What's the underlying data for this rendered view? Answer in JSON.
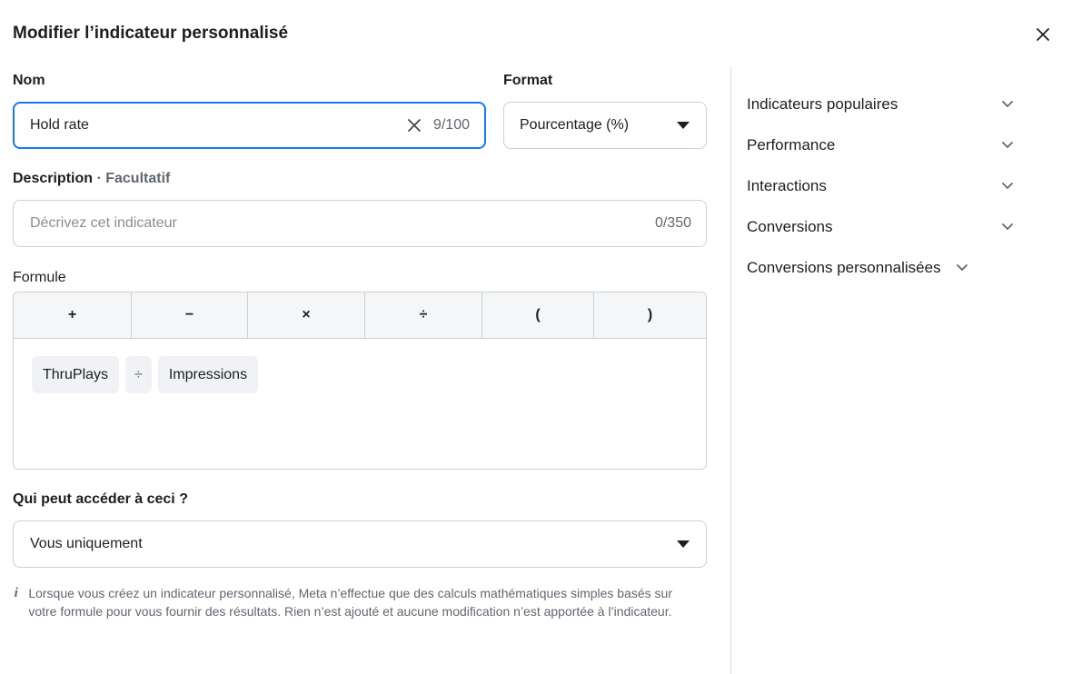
{
  "dialog": {
    "title": "Modifier l’indicateur personnalisé",
    "close_icon": "close-icon"
  },
  "name": {
    "label": "Nom",
    "value": "Hold rate",
    "counter": "9/100"
  },
  "format": {
    "label": "Format",
    "value": "Pourcentage (%)"
  },
  "description": {
    "label": "Description",
    "optional": " · Facultatif",
    "placeholder": "Décrivez cet indicateur",
    "counter": "0/350"
  },
  "formula": {
    "label": "Formule",
    "operators": [
      "+",
      "−",
      "×",
      "÷",
      "(",
      ")"
    ],
    "tokens": [
      {
        "text": "ThruPlays",
        "type": "metric"
      },
      {
        "text": "÷",
        "type": "operator"
      },
      {
        "text": "Impressions",
        "type": "metric"
      }
    ]
  },
  "access": {
    "label": "Qui peut accéder à ceci ?",
    "value": "Vous uniquement"
  },
  "note": {
    "icon": "info-icon",
    "text": "Lorsque vous créez un indicateur personnalisé, Meta n’effectue que des calculs mathématiques simples basés sur votre formule pour vous fournir des résultats. Rien n’est ajouté et aucune modification n’est apportée à l’indicateur."
  },
  "sidebar": {
    "items": [
      {
        "label": "Indicateurs populaires"
      },
      {
        "label": "Performance"
      },
      {
        "label": "Interactions"
      },
      {
        "label": "Conversions"
      },
      {
        "label": "Conversions personnalisées"
      }
    ]
  },
  "colors": {
    "focus": "#1877f2",
    "border": "#ccd0d5",
    "text": "#1c1e21",
    "muted": "#606770"
  }
}
